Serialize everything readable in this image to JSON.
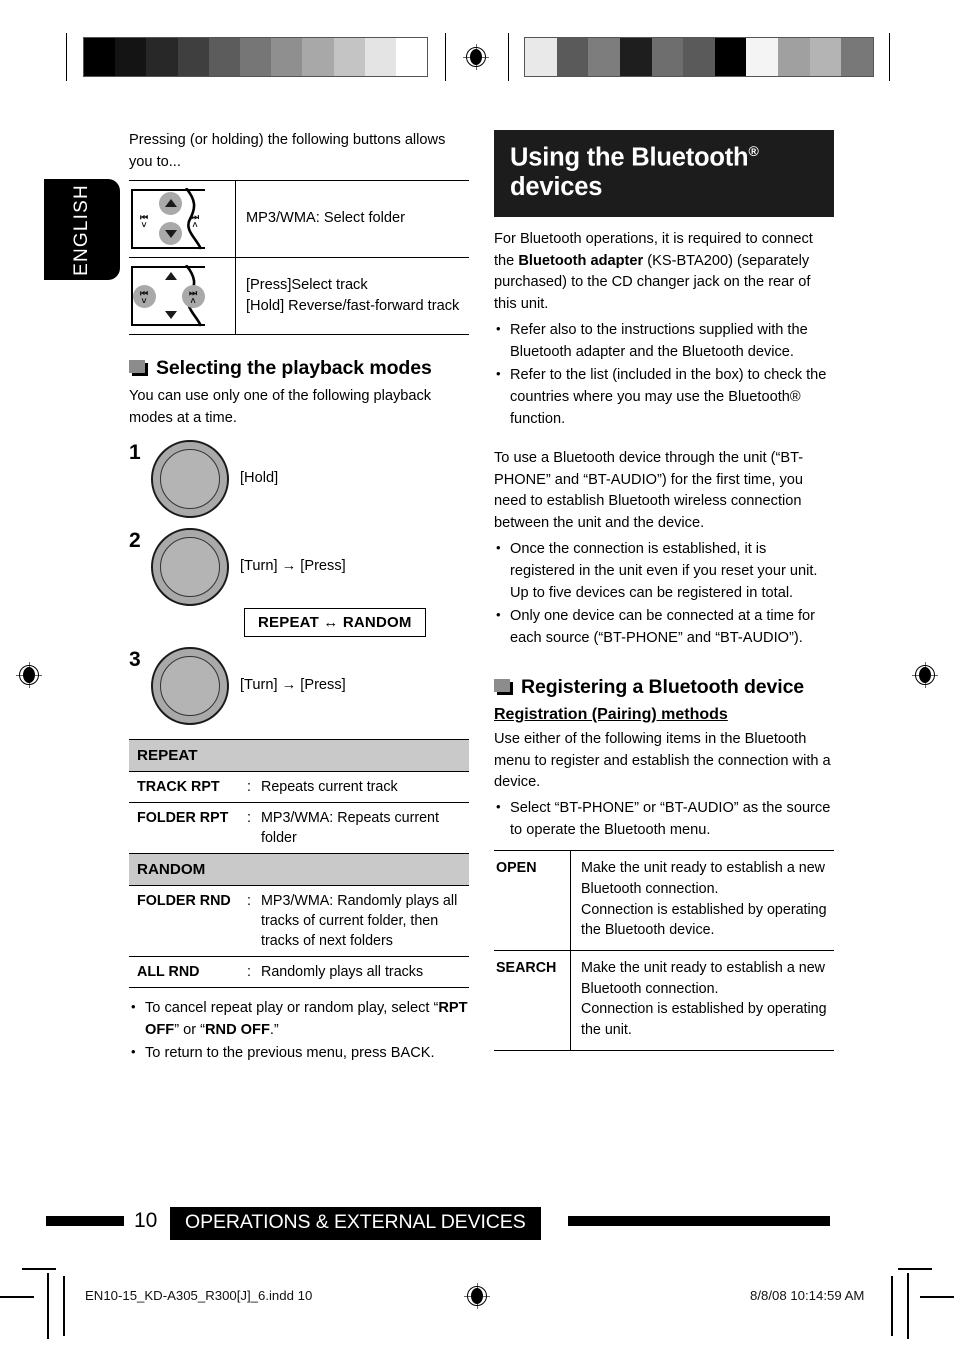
{
  "language_tab": {
    "label": "ENGLISH"
  },
  "left_column": {
    "intro": "Pressing (or holding) the following buttons allows you to...",
    "button_table": [
      {
        "icon": "folder-select-buttons-icon",
        "description": "MP3/WMA: Select folder"
      },
      {
        "icon": "track-select-buttons-icon",
        "description_line1": "[Press]Select track",
        "description_line2": "[Hold] Reverse/fast-forward track"
      }
    ],
    "playback_section": {
      "heading": "Selecting the playback modes",
      "intro": "You can use only one of the following playback modes at a time.",
      "steps": [
        {
          "number": "1",
          "action": "[Hold]"
        },
        {
          "number": "2",
          "action": "[Turn] → [Press]",
          "mode_box": "REPEAT ↔ RANDOM"
        },
        {
          "number": "3",
          "action": "[Turn] → [Press]"
        }
      ]
    },
    "modes_table": {
      "groups": [
        {
          "title": "REPEAT",
          "rows": [
            {
              "key": "TRACK RPT",
              "sep": ":",
              "value": "Repeats current track"
            },
            {
              "key": "FOLDER RPT",
              "sep": ":",
              "value": "MP3/WMA: Repeats current folder"
            }
          ]
        },
        {
          "title": "RANDOM",
          "rows": [
            {
              "key": "FOLDER RND",
              "sep": ":",
              "value": "MP3/WMA: Randomly plays all tracks of current folder, then tracks of next folders"
            },
            {
              "key": "ALL RND",
              "sep": ":",
              "value": "Randomly plays all tracks"
            }
          ]
        }
      ]
    },
    "notes": [
      "To cancel repeat play or random play, select “RPT OFF” or “RND OFF.”",
      "To return to the previous menu, press BACK."
    ],
    "notes_rich": {
      "note1_pre": "To cancel repeat play or random play, select “",
      "note1_b1": "RPT OFF",
      "note1_mid": "” or “",
      "note1_b2": "RND OFF",
      "note1_post": ".”",
      "note2": "To return to the previous menu, press BACK."
    }
  },
  "right_column": {
    "banner_title_line1": "Using the Bluetooth",
    "banner_title_sup": "®",
    "banner_title_line2": "devices",
    "intro_pre": "For Bluetooth operations, it is required to connect the ",
    "intro_bold": "Bluetooth adapter",
    "intro_post": " (KS-BTA200) (separately purchased) to the CD changer jack on the rear of this unit.",
    "intro_bullets": [
      "Refer also to the instructions supplied with the Bluetooth adapter and the Bluetooth device.",
      "Refer to the list (included in the box) to check the countries where you may use the Bluetooth® function."
    ],
    "second_para": "To use a Bluetooth device through the unit (“BT-PHONE” and “BT-AUDIO”) for the first time, you need to establish Bluetooth wireless connection between the unit and the device.",
    "second_bullets": [
      "Once the connection is established, it is registered in the unit even if you reset your unit. Up to five devices can be registered in total.",
      "Only one device can be connected at a time for each source (“BT-PHONE” and “BT-AUDIO”)."
    ],
    "registering_section": {
      "heading": "Registering a Bluetooth device",
      "subheading": "Registration (Pairing) methods",
      "para": "Use either of the following items in the Bluetooth menu to register and establish the connection with a device.",
      "bullets": [
        "Select “BT-PHONE” or “BT-AUDIO” as the source to operate the Bluetooth menu."
      ],
      "methods": [
        {
          "key": "OPEN",
          "lines": [
            "Make the unit ready to establish a new Bluetooth connection.",
            "Connection is established by operating the Bluetooth device."
          ]
        },
        {
          "key": "SEARCH",
          "lines": [
            "Make the unit ready to establish a new Bluetooth connection.",
            "Connection is established by operating the unit."
          ]
        }
      ]
    }
  },
  "footer": {
    "page_number": "10",
    "section_label": "OPERATIONS & EXTERNAL DEVICES",
    "imprint_file": "EN10-15_KD-A305_R300[J]_6.indd   10",
    "imprint_date": "8/8/08   10:14:59 AM"
  },
  "colors": {
    "black": "#000000",
    "banner_black": "#1c1c1c",
    "table_header_gray": "#c9c9c9",
    "knob_gray": "#a9a9a9",
    "marker_gray": "#8c8c8c",
    "white": "#ffffff"
  },
  "calibration": {
    "left_swatches": [
      "#000000",
      "#141414",
      "#282828",
      "#3f3f3f",
      "#5c5c5c",
      "#767676",
      "#8f8f8f",
      "#a8a8a8",
      "#c4c4c4",
      "#e4e4e4",
      "#ffffff"
    ],
    "right_swatches": [
      "#e9e9e9",
      "#5a5a5a",
      "#7d7d7d",
      "#1e1e1e",
      "#6e6e6e",
      "#5a5a5a",
      "#000000",
      "#f4f4f4",
      "#a0a0a0",
      "#b4b4b4",
      "#787878"
    ]
  }
}
